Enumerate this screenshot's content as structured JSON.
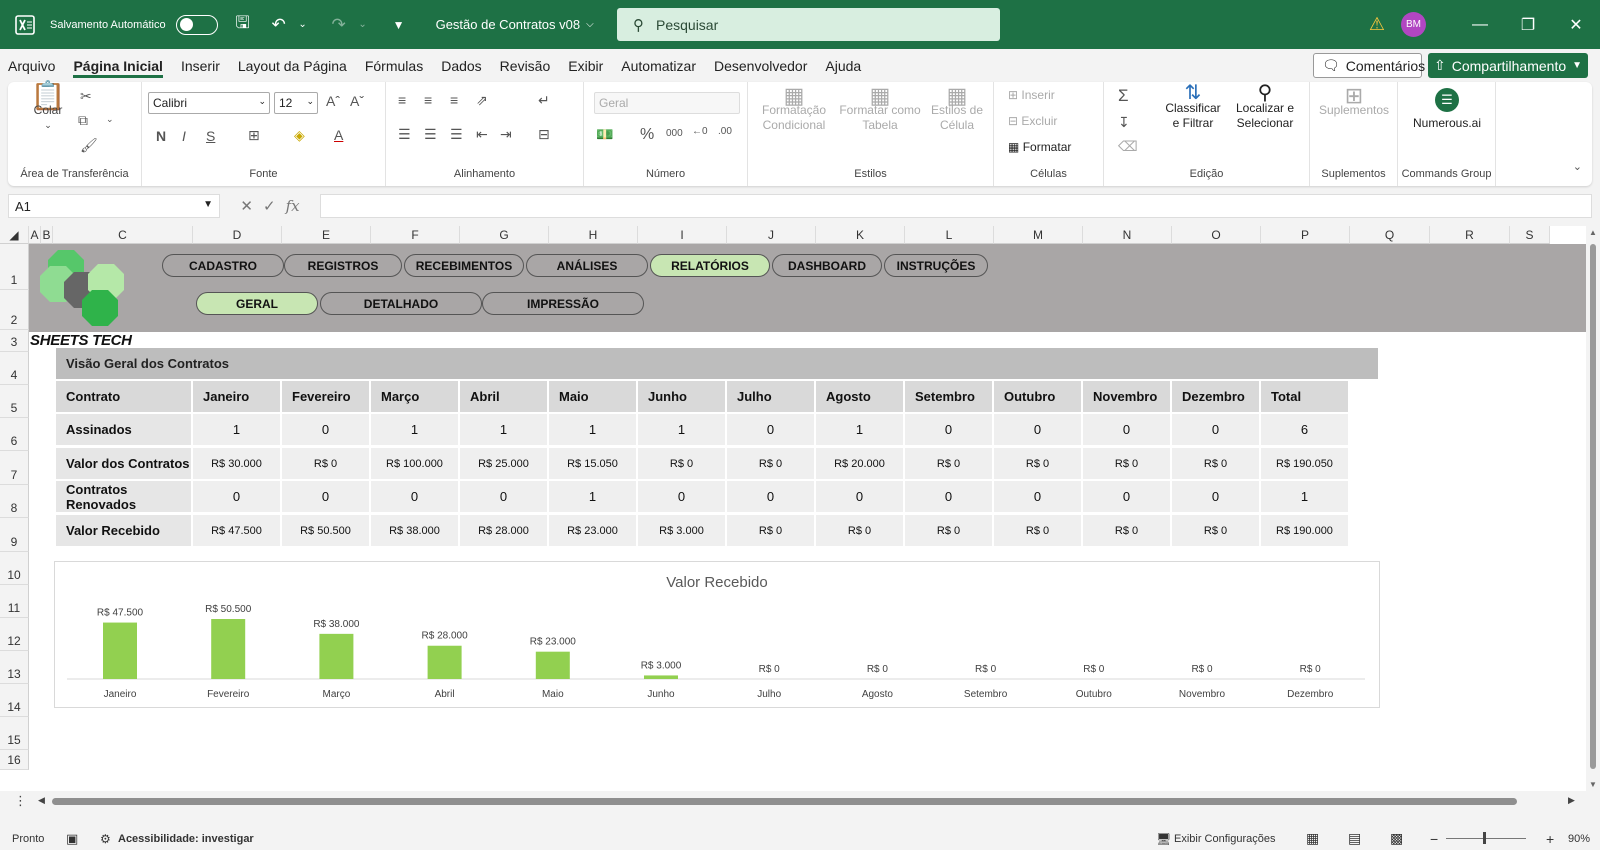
{
  "titlebar": {
    "autosave_label": "Salvamento Automático",
    "file_name": "Gestão de Contratos v08",
    "search_placeholder": "Pesquisar",
    "avatar_initials": "BM"
  },
  "menu": [
    "Arquivo",
    "Página Inicial",
    "Inserir",
    "Layout da Página",
    "Fórmulas",
    "Dados",
    "Revisão",
    "Exibir",
    "Automatizar",
    "Desenvolvedor",
    "Ajuda"
  ],
  "menu_active": "Página Inicial",
  "comments_label": "Comentários",
  "share_label": "Compartilhamento",
  "ribbon": {
    "clipboard": {
      "paste": "Colar",
      "label": "Área de Transferência"
    },
    "font": {
      "name": "Calibri",
      "size": "12",
      "label": "Fonte"
    },
    "alignment": {
      "label": "Alinhamento"
    },
    "number": {
      "format": "Geral",
      "label": "Número"
    },
    "styles": {
      "conditional": "Formatação Condicional",
      "table": "Formatar como Tabela",
      "cell": "Estilos de Célula",
      "label": "Estilos"
    },
    "cells": {
      "insert": "Inserir",
      "delete": "Excluir",
      "format": "Formatar",
      "label": "Células"
    },
    "editing": {
      "sort": "Classificar e Filtrar",
      "find": "Localizar e Selecionar",
      "label": "Edição"
    },
    "addins": {
      "addins": "Suplementos",
      "label": "Suplementos"
    },
    "commands": {
      "numerous": "Numerous.ai",
      "label": "Commands Group"
    }
  },
  "formula_bar": {
    "name_box": "A1",
    "fx": "fx",
    "formula": ""
  },
  "columns": [
    "A",
    "B",
    "C",
    "D",
    "E",
    "F",
    "G",
    "H",
    "I",
    "J",
    "K",
    "L",
    "M",
    "N",
    "O",
    "P",
    "Q",
    "R",
    "S"
  ],
  "rows": [
    "1",
    "2",
    "3",
    "4",
    "5",
    "6",
    "7",
    "8",
    "9",
    "10",
    "11",
    "12",
    "13",
    "14",
    "15",
    "16"
  ],
  "sheet": {
    "logo_text": "SHEETS TECH",
    "nav_top": [
      "CADASTRO",
      "REGISTROS",
      "RECEBIMENTOS",
      "ANÁLISES",
      "RELATÓRIOS",
      "DASHBOARD",
      "INSTRUÇÕES"
    ],
    "nav_top_active": "RELATÓRIOS",
    "nav_sub": [
      "GERAL",
      "DETALHADO",
      "IMPRESSÃO"
    ],
    "nav_sub_active": "GERAL",
    "table_title": "Visão Geral dos Contratos",
    "headers": [
      "Contrato",
      "Janeiro",
      "Fevereiro",
      "Março",
      "Abril",
      "Maio",
      "Junho",
      "Julho",
      "Agosto",
      "Setembro",
      "Outubro",
      "Novembro",
      "Dezembro",
      "Total"
    ],
    "rows": [
      {
        "label": "Assinados",
        "values": [
          "1",
          "0",
          "1",
          "1",
          "1",
          "1",
          "0",
          "1",
          "0",
          "0",
          "0",
          "0",
          "6"
        ]
      },
      {
        "label": "Valor dos Contratos",
        "values": [
          "R$ 30.000",
          "R$ 0",
          "R$ 100.000",
          "R$ 25.000",
          "R$ 15.050",
          "R$ 0",
          "R$ 0",
          "R$ 20.000",
          "R$ 0",
          "R$ 0",
          "R$ 0",
          "R$ 0",
          "R$ 190.050"
        ]
      },
      {
        "label": "Contratos Renovados",
        "values": [
          "0",
          "0",
          "0",
          "0",
          "1",
          "0",
          "0",
          "0",
          "0",
          "0",
          "0",
          "0",
          "1"
        ]
      },
      {
        "label": "Valor Recebido",
        "values": [
          "R$ 47.500",
          "R$ 50.500",
          "R$ 38.000",
          "R$ 28.000",
          "R$ 23.000",
          "R$ 3.000",
          "R$ 0",
          "R$ 0",
          "R$ 0",
          "R$ 0",
          "R$ 0",
          "R$ 0",
          "R$ 190.000"
        ]
      }
    ]
  },
  "chart_data": {
    "type": "bar",
    "title": "Valor Recebido",
    "categories": [
      "Janeiro",
      "Fevereiro",
      "Março",
      "Abril",
      "Maio",
      "Junho",
      "Julho",
      "Agosto",
      "Setembro",
      "Outubro",
      "Novembro",
      "Dezembro"
    ],
    "values": [
      47500,
      50500,
      38000,
      28000,
      23000,
      3000,
      0,
      0,
      0,
      0,
      0,
      0
    ],
    "data_labels": [
      "R$ 47.500",
      "R$ 50.500",
      "R$ 38.000",
      "R$ 28.000",
      "R$ 23.000",
      "R$ 3.000",
      "R$ 0",
      "R$ 0",
      "R$ 0",
      "R$ 0",
      "R$ 0",
      "R$ 0"
    ],
    "bar_color": "#92d050",
    "grid": false
  },
  "status": {
    "ready": "Pronto",
    "accessibility": "Acessibilidade: investigar",
    "display_settings": "Exibir Configurações",
    "zoom": "90%"
  },
  "colors": {
    "brand": "#1e7145",
    "band": "#a9a6a6",
    "active_pill": "#c8e6b3"
  }
}
